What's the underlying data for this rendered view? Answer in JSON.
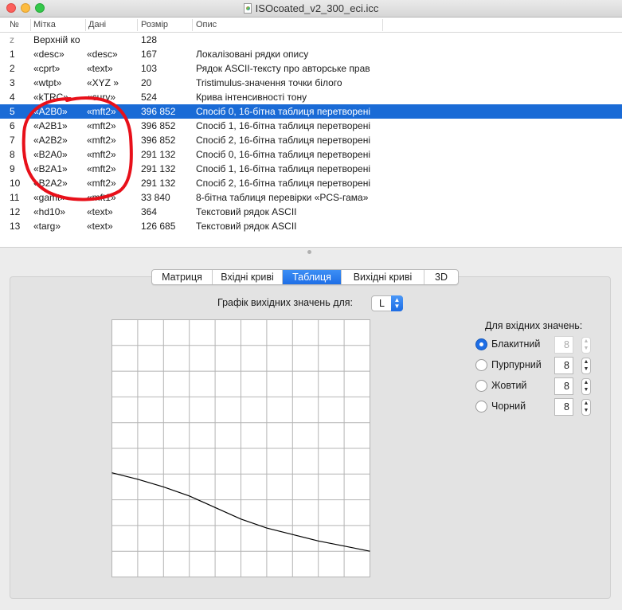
{
  "window": {
    "title": "ISOcoated_v2_300_eci.icc"
  },
  "table": {
    "headers": [
      "№",
      "Мітка",
      "Дані",
      "Розмір",
      "Опис"
    ],
    "rows": [
      {
        "num": "z",
        "tag": "Верхній ко",
        "data": "",
        "size": "128",
        "desc": ""
      },
      {
        "num": "1",
        "tag": "«desc»",
        "data": "«desc»",
        "size": "167",
        "desc": "Локалізовані рядки опису"
      },
      {
        "num": "2",
        "tag": "«cprt»",
        "data": "«text»",
        "size": "103",
        "desc": "Рядок ASCII-тексту про авторське прав"
      },
      {
        "num": "3",
        "tag": "«wtpt»",
        "data": "«XYZ »",
        "size": "20",
        "desc": "Tristimulus-значення точки білого"
      },
      {
        "num": "4",
        "tag": "«kTRC»",
        "data": "«curv»",
        "size": "524",
        "desc": "Крива інтенсивності тону"
      },
      {
        "num": "5",
        "tag": "«A2B0»",
        "data": "«mft2»",
        "size": "396 852",
        "desc": "Спосіб 0, 16-бітна таблиця перетворені"
      },
      {
        "num": "6",
        "tag": "«A2B1»",
        "data": "«mft2»",
        "size": "396 852",
        "desc": "Спосіб 1, 16-бітна таблиця перетворені"
      },
      {
        "num": "7",
        "tag": "«A2B2»",
        "data": "«mft2»",
        "size": "396 852",
        "desc": "Спосіб 2, 16-бітна таблиця перетворені"
      },
      {
        "num": "8",
        "tag": "«B2A0»",
        "data": "«mft2»",
        "size": "291 132",
        "desc": "Спосіб 0, 16-бітна таблиця перетворені"
      },
      {
        "num": "9",
        "tag": "«B2A1»",
        "data": "«mft2»",
        "size": "291 132",
        "desc": "Спосіб 1, 16-бітна таблиця перетворені"
      },
      {
        "num": "10",
        "tag": "«B2A2»",
        "data": "«mft2»",
        "size": "291 132",
        "desc": "Спосіб 2, 16-бітна таблиця перетворені"
      },
      {
        "num": "11",
        "tag": "«gamt»",
        "data": "«mft1»",
        "size": "33 840",
        "desc": "8-бітна таблиця перевірки «PCS-гама»"
      },
      {
        "num": "12",
        "tag": "«hd10»",
        "data": "«text»",
        "size": "364",
        "desc": "Текстовий рядок ASCII"
      },
      {
        "num": "13",
        "tag": "«targ»",
        "data": "«text»",
        "size": "126 685",
        "desc": "Текстовий рядок ASCII"
      }
    ],
    "selected_row_index": 5
  },
  "tabs": [
    {
      "label": "Матриця",
      "active": false
    },
    {
      "label": "Вхідні криві",
      "active": false
    },
    {
      "label": "Таблиця",
      "active": true
    },
    {
      "label": "Вихідні криві",
      "active": false
    },
    {
      "label": "3D",
      "active": false
    }
  ],
  "graph": {
    "label": "Графік вихідних значень для:",
    "channel_value": "L"
  },
  "inputs": {
    "title": "Для вхідних значень:",
    "channels": [
      {
        "label": "Блакитний",
        "value": "8",
        "selected": true
      },
      {
        "label": "Пурпурний",
        "value": "8",
        "selected": false
      },
      {
        "label": "Жовтий",
        "value": "8",
        "selected": false
      },
      {
        "label": "Чорний",
        "value": "8",
        "selected": false
      }
    ]
  },
  "colors": {
    "selection": "#1a6bd6",
    "annotation": "#e8101a",
    "curve": "#000000",
    "grid_line": "#b4b4b4"
  },
  "chart_data": {
    "type": "line",
    "xlim": [
      0,
      1
    ],
    "ylim": [
      0,
      1
    ],
    "grid": true,
    "x": [
      0,
      0.1,
      0.2,
      0.3,
      0.4,
      0.5,
      0.6,
      0.7,
      0.8,
      0.9,
      1.0
    ],
    "y": [
      0.405,
      0.38,
      0.35,
      0.315,
      0.27,
      0.225,
      0.19,
      0.165,
      0.14,
      0.12,
      0.1
    ]
  }
}
